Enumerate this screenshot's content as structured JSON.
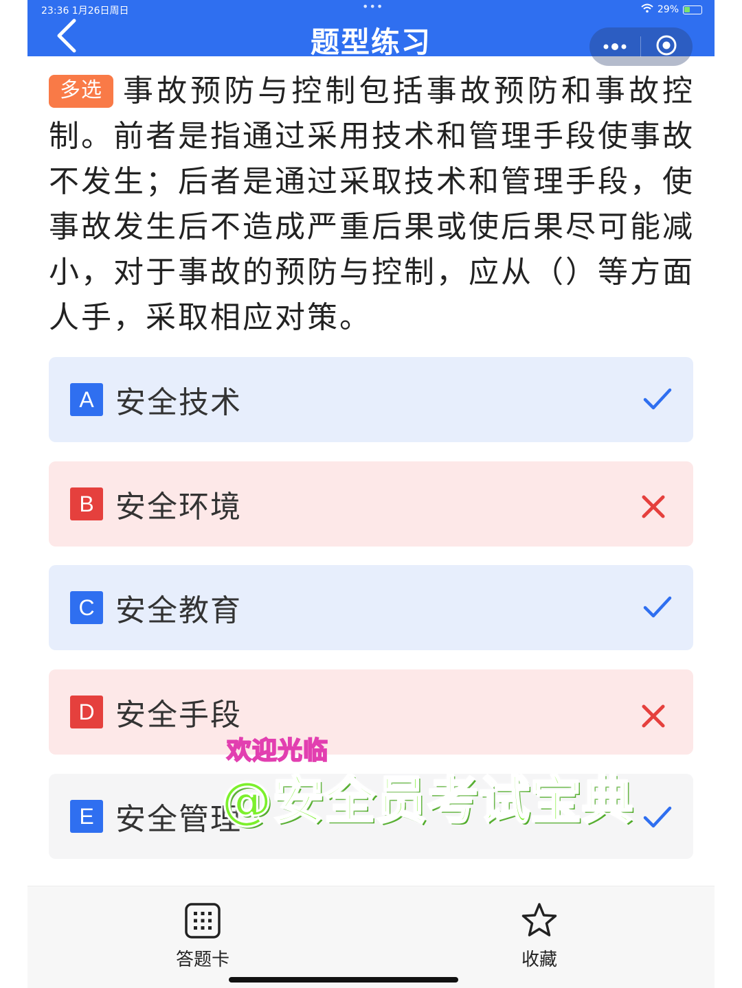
{
  "status_bar": {
    "time": "23:36  1月26日周日",
    "dots": "•••",
    "battery": "29%"
  },
  "header": {
    "title": "题型练习",
    "back_icon": "chevron-left-icon",
    "more_icon": "more-dots-icon",
    "close_icon": "target-circle-icon"
  },
  "question": {
    "type_tag": "多选",
    "text": "事故预防与控制包括事故预防和事故控制。前者是指通过采用技术和管理手段使事故不发生；后者是通过采取技术和管理手段，使事故发生后不造成严重后果或使后果尽可能减小，对于事故的预防与控制，应从（）等方面人手，采取相应对策。"
  },
  "options": [
    {
      "letter": "A",
      "text": "安全技术",
      "state": "correct",
      "mark_icon": "check-icon"
    },
    {
      "letter": "B",
      "text": "安全环境",
      "state": "wrong",
      "mark_icon": "cross-icon"
    },
    {
      "letter": "C",
      "text": "安全教育",
      "state": "correct",
      "mark_icon": "check-icon"
    },
    {
      "letter": "D",
      "text": "安全手段",
      "state": "wrong",
      "mark_icon": "cross-icon"
    },
    {
      "letter": "E",
      "text": "安全管理",
      "state": "neutral",
      "mark_icon": "check-icon"
    }
  ],
  "watermark": {
    "small": "欢迎光临",
    "big": "@安全员考试宝典"
  },
  "bottom_bar": {
    "answer_card_label": "答题卡",
    "answer_card_icon": "grid-keypad-icon",
    "favorite_label": "收藏",
    "favorite_icon": "star-icon"
  },
  "colors": {
    "accent": "#2f6ff0",
    "wrong": "#e5403d",
    "tag": "#f97a47",
    "correct_bg": "#e7eefc",
    "wrong_bg": "#fde8e8"
  }
}
